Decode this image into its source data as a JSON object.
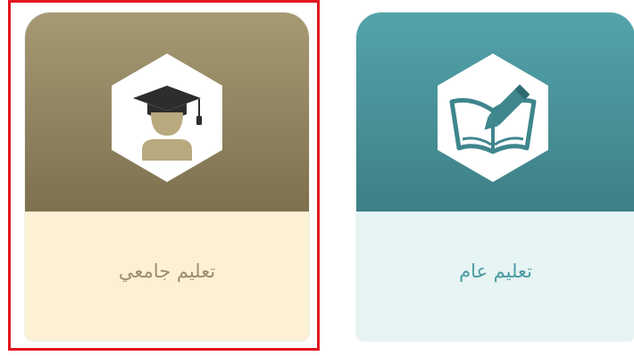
{
  "cards": [
    {
      "label": "تعليم جامعي",
      "icon": "graduate-icon",
      "selected": true,
      "colors": {
        "top": "#a69a74",
        "bottom": "#fcf0d5",
        "text": "#9b8e6c"
      }
    },
    {
      "label": "تعليم عام",
      "icon": "book-pencil-icon",
      "selected": false,
      "colors": {
        "top": "#53a3ab",
        "bottom": "#e6f4f3",
        "text": "#4b9aa2"
      }
    }
  ],
  "selection_color": "#e1141e"
}
